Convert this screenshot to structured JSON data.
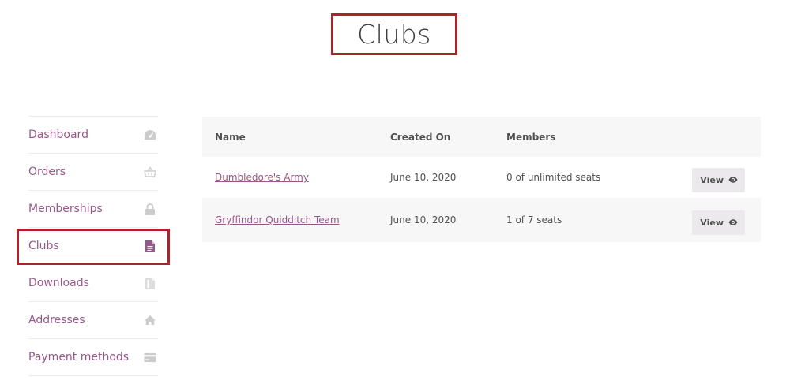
{
  "page": {
    "title": "Clubs"
  },
  "sidebar": {
    "items": [
      {
        "label": "Dashboard",
        "icon": "dashboard-gauge-icon"
      },
      {
        "label": "Orders",
        "icon": "basket-icon"
      },
      {
        "label": "Memberships",
        "icon": "lock-icon"
      },
      {
        "label": "Clubs",
        "icon": "document-icon",
        "active": true
      },
      {
        "label": "Downloads",
        "icon": "file-download-icon"
      },
      {
        "label": "Addresses",
        "icon": "home-icon"
      },
      {
        "label": "Payment methods",
        "icon": "credit-card-icon"
      }
    ]
  },
  "table": {
    "headers": {
      "name": "Name",
      "created_on": "Created On",
      "members": "Members"
    },
    "rows": [
      {
        "name": "Dumbledore's Army",
        "created_on": "June 10, 2020",
        "members": "0 of unlimited seats",
        "action": "View"
      },
      {
        "name": "Gryffindor Quidditch Team",
        "created_on": "June 10, 2020",
        "members": "1 of 7 seats",
        "action": "View"
      }
    ]
  },
  "colors": {
    "accent": "#96588a",
    "highlight_border": "#a8262b",
    "icon_muted": "#cccccc"
  }
}
